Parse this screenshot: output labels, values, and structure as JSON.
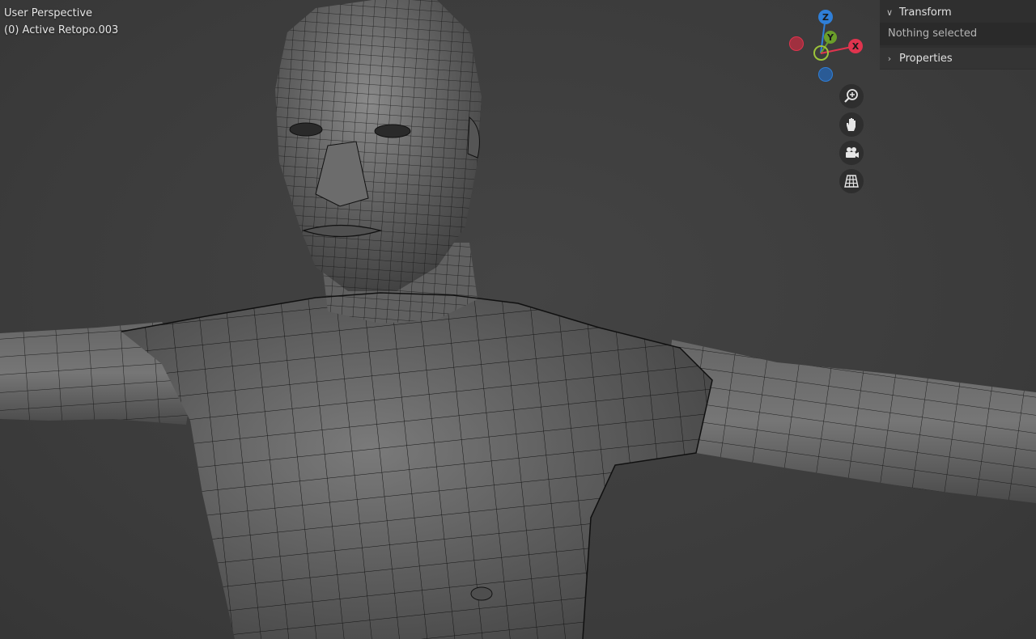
{
  "viewport": {
    "view_name": "User Perspective",
    "active_object": "(0) Active Retopo.003"
  },
  "gizmo": {
    "axes": [
      {
        "id": "z",
        "label": "Z",
        "color": "#2f7fd8"
      },
      {
        "id": "y",
        "label": "Y",
        "color": "#6a9e2a"
      },
      {
        "id": "x",
        "label": "X",
        "color": "#e0344e"
      },
      {
        "id": "neg-x",
        "label": "",
        "color": "#a0303f"
      },
      {
        "id": "neg-y",
        "label": "",
        "color": "#5e8a22"
      },
      {
        "id": "neg-z",
        "label": "",
        "color": "#2a5b96"
      }
    ]
  },
  "nav_buttons": [
    {
      "name": "zoom-button",
      "icon": "magnifier-plus-icon"
    },
    {
      "name": "pan-button",
      "icon": "hand-icon"
    },
    {
      "name": "camera-view-button",
      "icon": "camera-icon"
    },
    {
      "name": "ortho-perspective-button",
      "icon": "grid-icon"
    }
  ],
  "sidebar": {
    "transform": {
      "title": "Transform",
      "body": "Nothing selected",
      "expanded": true
    },
    "properties": {
      "title": "Properties",
      "expanded": false
    }
  },
  "colors": {
    "background": "#3d3d3d",
    "mesh_fill": "#5a5a5a",
    "wire": "#111111",
    "panel": "#2f2f2f"
  }
}
